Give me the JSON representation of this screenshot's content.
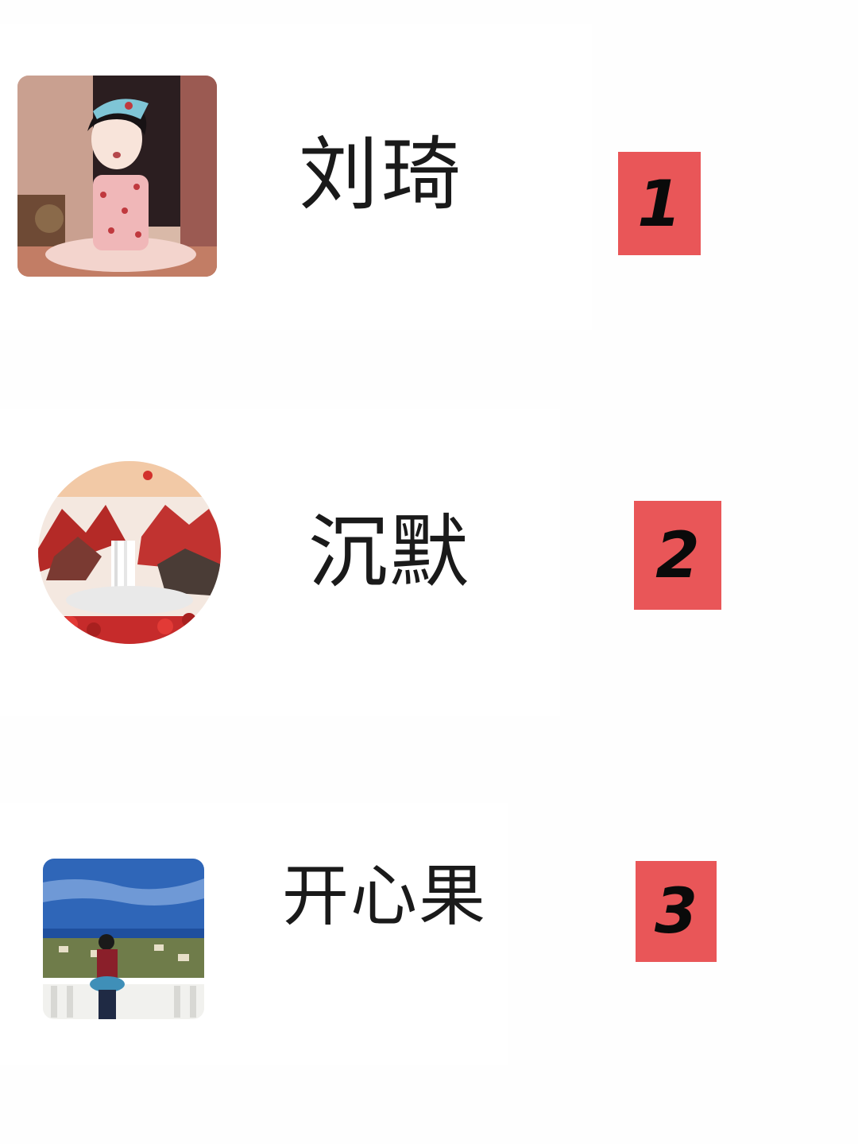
{
  "ranking": [
    {
      "rank": "1",
      "name": "刘琦",
      "avatar": "cartoon-girl-avatar-icon"
    },
    {
      "rank": "2",
      "name": "沉默",
      "avatar": "landscape-painting-avatar-icon"
    },
    {
      "rank": "3",
      "name": "开心果",
      "avatar": "balcony-scenery-avatar-icon"
    }
  ],
  "colors": {
    "rank_badge": "#e95658",
    "name_text": "#1a1a1a",
    "background": "#ffffff"
  }
}
